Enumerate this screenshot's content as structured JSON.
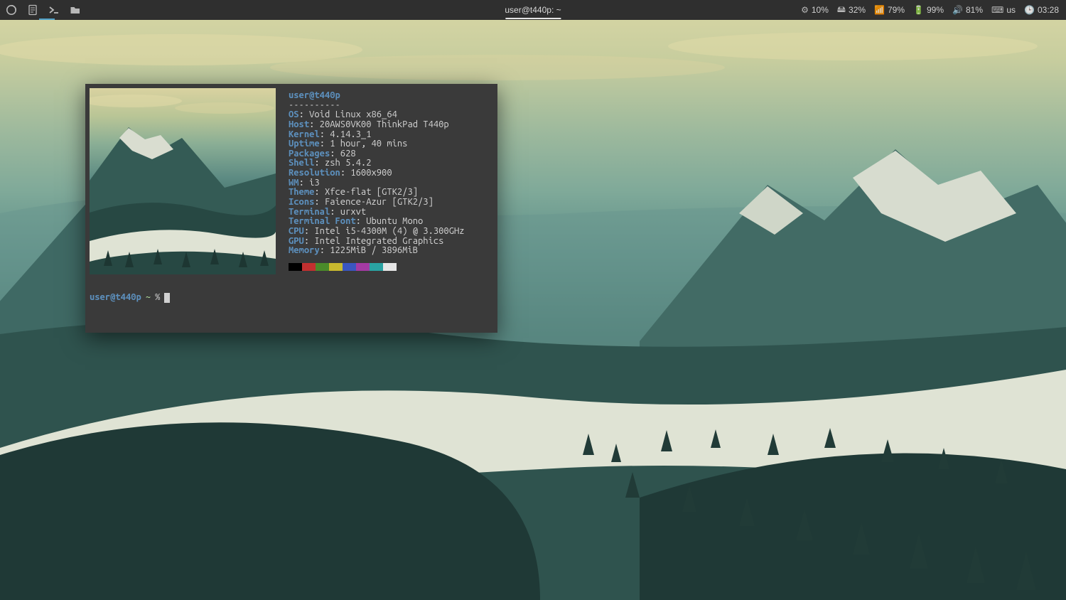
{
  "panel": {
    "window_title": "user@t440p: ~",
    "tray": {
      "firefox": "firefox-icon",
      "editor": "text-editor-icon",
      "terminal": "terminal-icon",
      "files": "file-manager-icon"
    },
    "status": {
      "cpu_pct": "10%",
      "disk_pct": "32%",
      "wifi_pct": "79%",
      "battery_pct": "99%",
      "volume_pct": "81%",
      "kbd_layout": "us",
      "clock": "03:28"
    }
  },
  "neofetch": {
    "userhost": "user@t440p",
    "dashes": "----------",
    "fields": {
      "OS": "Void Linux x86_64",
      "Host": "20AWS0VK00 ThinkPad T440p",
      "Kernel": "4.14.3_1",
      "Uptime": "1 hour, 40 mins",
      "Packages": "628",
      "Shell": "zsh 5.4.2",
      "Resolution": "1600x900",
      "WM": "i3",
      "Theme": "Xfce-flat [GTK2/3]",
      "Icons": "Faience-Azur [GTK2/3]",
      "Terminal": "urxvt",
      "Terminal Font": "Ubuntu Mono",
      "CPU": "Intel i5-4300M (4) @ 3.300GHz",
      "GPU": "Intel Integrated Graphics",
      "Memory": "1225MiB / 3896MiB"
    },
    "swatches": [
      "#000000",
      "#c23030",
      "#4a8a2a",
      "#c8b92e",
      "#3a56c0",
      "#a33aa3",
      "#2aa3a3",
      "#e6e6e6"
    ]
  },
  "prompt": {
    "ps1": "user@t440p",
    "cwd": "~",
    "symbol": "%"
  }
}
